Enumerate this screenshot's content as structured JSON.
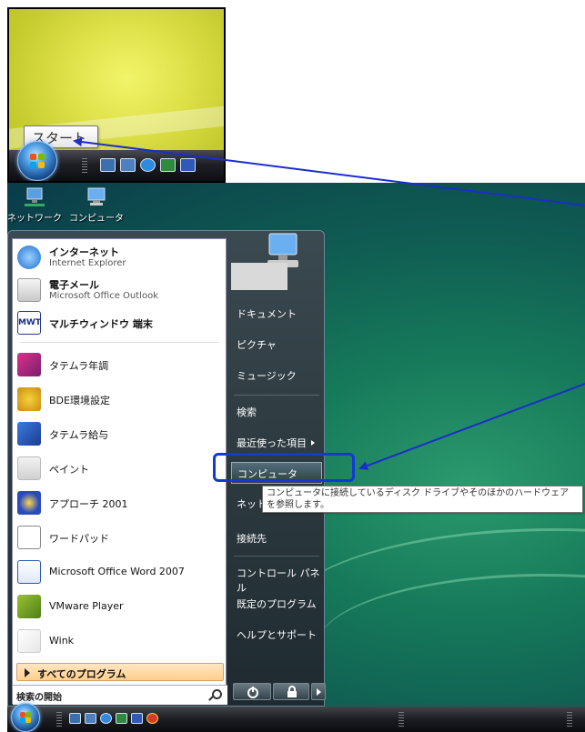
{
  "inset": {
    "start_tooltip": "スタート"
  },
  "desktop": {
    "icons": [
      {
        "label": "ネットワーク"
      },
      {
        "label": "コンピュータ"
      }
    ]
  },
  "start_menu": {
    "pinned": [
      {
        "title": "インターネット",
        "subtitle": "Internet Explorer"
      },
      {
        "title": "電子メール",
        "subtitle": "Microsoft Office Outlook"
      },
      {
        "title": "マルチウィンドウ 端末"
      }
    ],
    "recent": [
      {
        "label": "タテムラ年調"
      },
      {
        "label": "BDE環境設定"
      },
      {
        "label": "タテムラ給与"
      },
      {
        "label": "ペイント"
      },
      {
        "label": "アプローチ 2001"
      },
      {
        "label": "ワードパッド"
      },
      {
        "label": "Microsoft Office Word 2007"
      },
      {
        "label": "VMware Player"
      },
      {
        "label": "Wink"
      }
    ],
    "all_programs": "すべてのプログラム",
    "search_placeholder": "検索の開始",
    "right": {
      "documents": "ドキュメント",
      "pictures": "ピクチャ",
      "music": "ミュージック",
      "search": "検索",
      "recent_items": "最近使った項目",
      "computer": "コンピュータ",
      "network": "ネット",
      "connect_to": "接続先",
      "control_panel": "コントロール パネル",
      "default_programs": "既定のプログラム",
      "help": "ヘルプとサポート"
    },
    "tooltip_line1": "コンピュータに接続しているディスク ドライブやそのほかのハードウェア",
    "tooltip_line2": "を参照します。"
  },
  "colors": {
    "highlight": "#1438d6",
    "arrow": "#1a2ec9"
  }
}
